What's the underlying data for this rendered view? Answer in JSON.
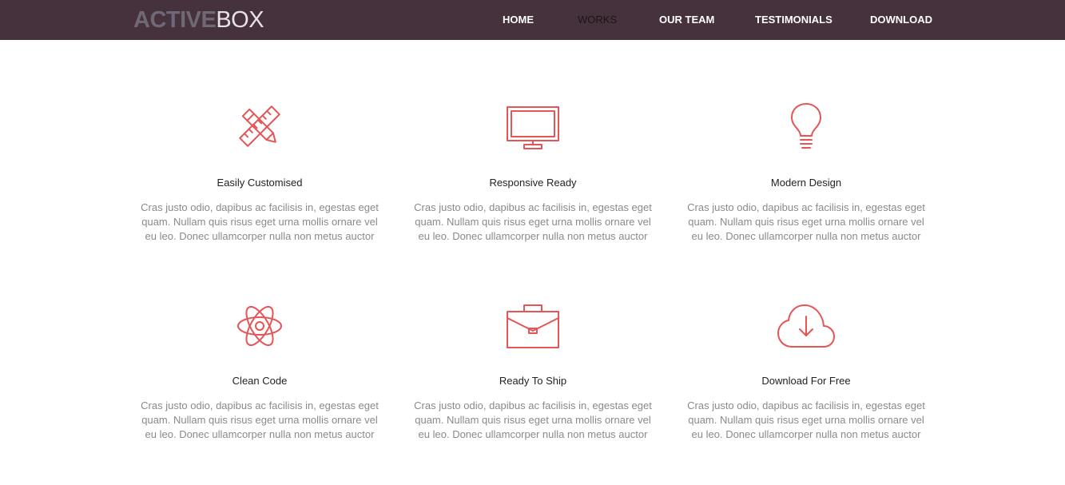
{
  "header": {
    "logo_bold": "ACTIVE",
    "logo_light": "BOX",
    "nav": [
      "HOME",
      "WORKS",
      "OUR TEAM",
      "TESTIMONIALS",
      "DOWNLOAD"
    ],
    "active_nav": "WORKS"
  },
  "colors": {
    "navbar_bg": "#46323c",
    "accent": "#e65555",
    "title_text": "#222222",
    "body_text": "#8a8a8a"
  },
  "features": [
    {
      "icon": "pencil-ruler-icon",
      "title": "Easily Customised",
      "desc_lines": [
        "Cras justo odio, dapibus ac facilisis in, egestas eget",
        "quam. Nullam quis risus eget urna mollis ornare vel",
        "eu leo. Donec ullamcorper nulla non metus auctor"
      ]
    },
    {
      "icon": "monitor-icon",
      "title": "Responsive Ready",
      "desc_lines": [
        "Cras justo odio, dapibus ac facilisis in, egestas eget",
        "quam. Nullam quis risus eget urna mollis ornare vel",
        "eu leo. Donec ullamcorper nulla non metus auctor"
      ]
    },
    {
      "icon": "lightbulb-icon",
      "title": "Modern Design",
      "desc_lines": [
        "Cras justo odio, dapibus ac facilisis in, egestas eget",
        "quam. Nullam quis risus eget urna mollis ornare vel",
        "eu leo. Donec ullamcorper nulla non metus auctor"
      ]
    },
    {
      "icon": "atom-icon",
      "title": "Clean Code",
      "desc_lines": [
        "Cras justo odio, dapibus ac facilisis in, egestas eget",
        "quam. Nullam quis risus eget urna mollis ornare vel",
        "eu leo. Donec ullamcorper nulla non metus auctor"
      ]
    },
    {
      "icon": "briefcase-icon",
      "title": "Ready To Ship",
      "desc_lines": [
        "Cras justo odio, dapibus ac facilisis in, egestas eget",
        "quam. Nullam quis risus eget urna mollis ornare vel",
        "eu leo. Donec ullamcorper nulla non metus auctor"
      ]
    },
    {
      "icon": "cloud-download-icon",
      "title": "Download For Free",
      "desc_lines": [
        "Cras justo odio, dapibus ac facilisis in, egestas eget",
        "quam. Nullam quis risus eget urna mollis ornare vel",
        "eu leo. Donec ullamcorper nulla non metus auctor"
      ]
    }
  ]
}
